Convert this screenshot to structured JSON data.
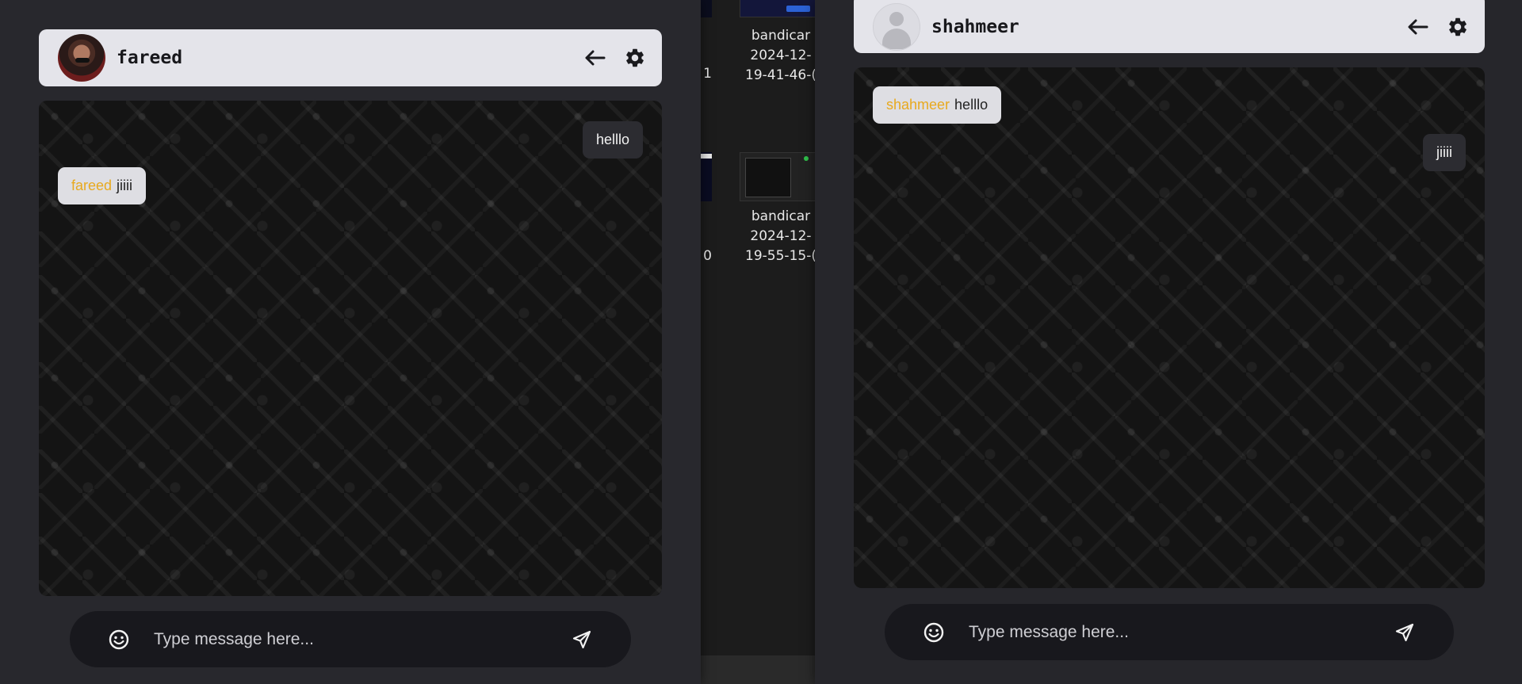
{
  "background_explorer": {
    "files": [
      {
        "name_line1": "bandicar",
        "name_line2": "2024-12-",
        "name_line3": "19-41-46-(",
        "left_cut": "1"
      },
      {
        "name_line1": "bandicar",
        "name_line2": "2024-12-",
        "name_line3": "19-55-15-(",
        "left_cut": "0"
      }
    ]
  },
  "windows": [
    {
      "header": {
        "username": "fareed",
        "avatar": "user-photo",
        "back_icon": "arrow-left-icon",
        "settings_icon": "gear-icon"
      },
      "messages": [
        {
          "type": "own",
          "text": "helllo"
        },
        {
          "type": "other",
          "sender": "fareed",
          "text": "jiiii"
        }
      ],
      "composer": {
        "placeholder": "Type message here...",
        "emoji_icon": "smiley-icon",
        "send_icon": "send-icon"
      }
    },
    {
      "header": {
        "username": "shahmeer",
        "avatar": "default-avatar",
        "back_icon": "arrow-left-icon",
        "settings_icon": "gear-icon"
      },
      "messages": [
        {
          "type": "other",
          "sender": "shahmeer",
          "text": "helllo"
        },
        {
          "type": "own",
          "text": "jiiii"
        }
      ],
      "composer": {
        "placeholder": "Type message here...",
        "emoji_icon": "smiley-icon",
        "send_icon": "send-icon"
      }
    }
  ],
  "colors": {
    "sender_name": "#e8a91e",
    "header_bg": "#e4e4ea",
    "chat_bg": "#141414",
    "own_bubble": "#2c2c31",
    "other_bubble": "#dedee3"
  }
}
